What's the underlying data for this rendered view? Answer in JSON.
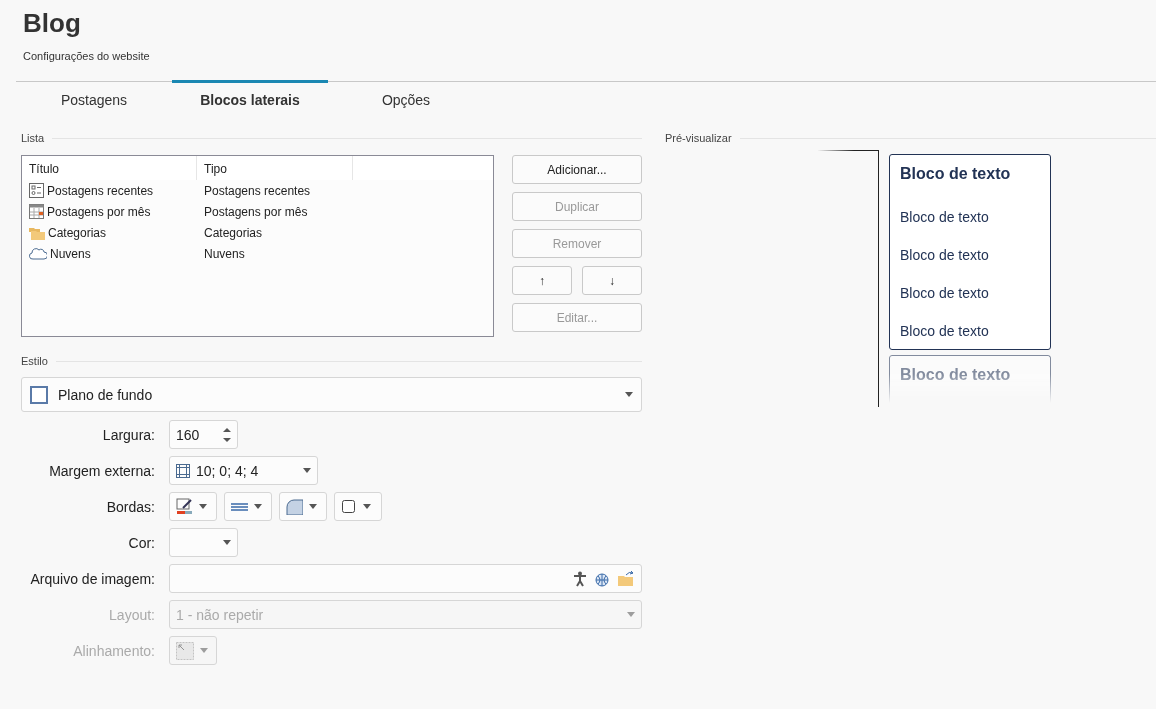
{
  "header": {
    "title": "Blog",
    "subtitle": "Configurações do website"
  },
  "tabs": [
    {
      "label": "Postagens",
      "selected": false
    },
    {
      "label": "Blocos laterais",
      "selected": true
    },
    {
      "label": "Opções",
      "selected": false
    }
  ],
  "list": {
    "label": "Lista",
    "columns": [
      "Título",
      "Tipo"
    ],
    "rows": [
      {
        "kind": "list",
        "title": "Postagens recentes",
        "type": "Postagens recentes"
      },
      {
        "kind": "calendar",
        "title": "Postagens por mês",
        "type": "Postagens por mês"
      },
      {
        "kind": "folder",
        "title": "Categorias",
        "type": "Categorias"
      },
      {
        "kind": "cloud",
        "title": "Nuvens",
        "type": "Nuvens"
      }
    ]
  },
  "buttons": [
    {
      "label": "Adicionar...",
      "kind": "wide",
      "disabled": false
    },
    {
      "label": "Duplicar",
      "kind": "wide",
      "disabled": true
    },
    {
      "label": "Remover",
      "kind": "wide",
      "disabled": true
    },
    {
      "label": "↑",
      "kind": "half",
      "disabled": false
    },
    {
      "label": "↓",
      "kind": "half",
      "disabled": false
    },
    {
      "label": "Editar...",
      "kind": "wide",
      "disabled": true
    }
  ],
  "style": {
    "label": "Estilo",
    "value": "Plano de fundo",
    "fields": [
      {
        "kind": "spin",
        "label": "Largura:",
        "value": "160",
        "disabled": false
      },
      {
        "kind": "combo",
        "label": "Margem externa:",
        "value": "10; 0; 4; 4",
        "disabled": false
      },
      {
        "kind": "borders",
        "label": "Bordas:",
        "disabled": false
      },
      {
        "kind": "color",
        "label": "Cor:",
        "disabled": false
      },
      {
        "kind": "file",
        "label": "Arquivo de imagem:",
        "disabled": false
      },
      {
        "kind": "select",
        "label": "Layout:",
        "value": "1 - não repetir",
        "disabled": true
      },
      {
        "kind": "align",
        "label": "Alinhamento:",
        "disabled": true
      }
    ]
  },
  "preview": {
    "label": "Pré-visualizar",
    "blocks": [
      {
        "heading": "Bloco de texto",
        "items": [
          "Bloco de texto",
          "Bloco de texto",
          "Bloco de texto",
          "Bloco de texto"
        ],
        "faded": false
      },
      {
        "heading": "Bloco de texto",
        "faded": true
      }
    ]
  }
}
